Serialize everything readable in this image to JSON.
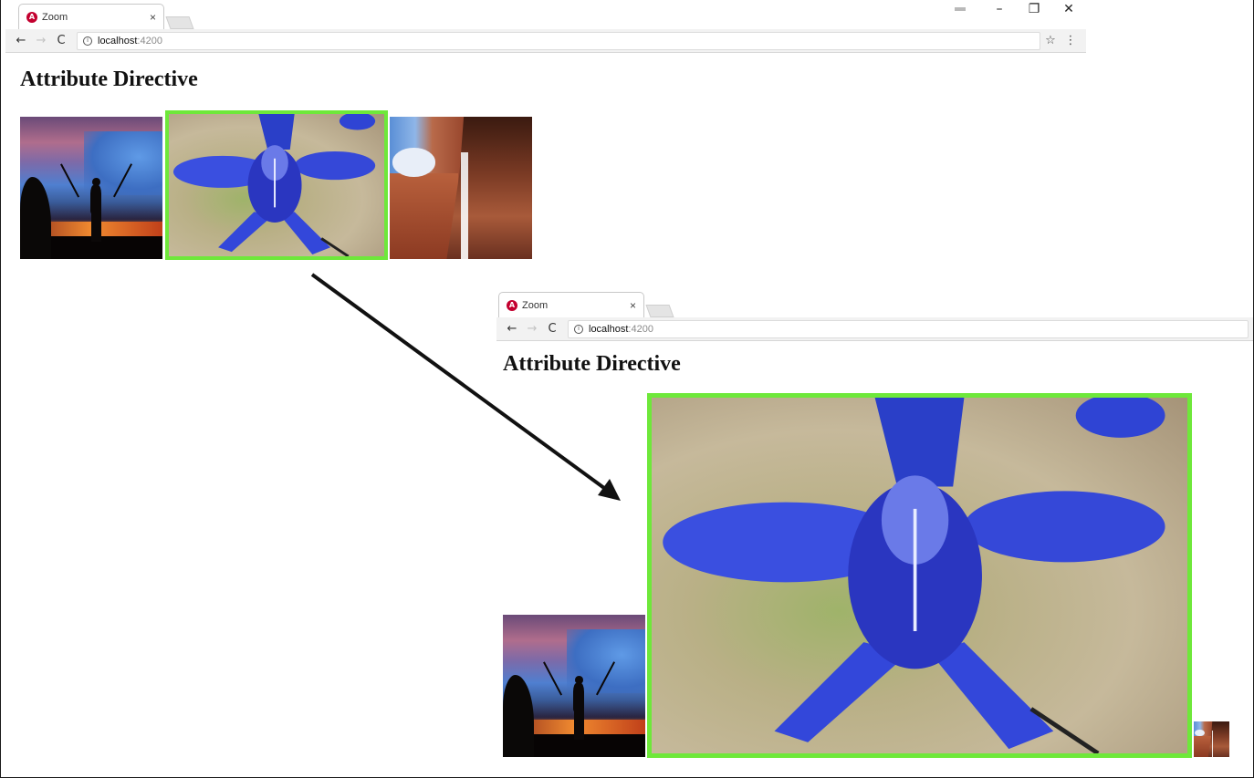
{
  "browser_top": {
    "tab": {
      "title": "Zoom",
      "close": "×",
      "logo_letter": "A"
    },
    "user_badge": "",
    "window_controls": {
      "minimize": "–",
      "restore": "❐",
      "close": "✕"
    },
    "nav": {
      "back": "←",
      "forward": "→",
      "reload": "C"
    },
    "address": {
      "host": "localhost",
      "port": ":4200"
    },
    "toolbar_icons": {
      "star": "☆",
      "menu": "⋮"
    },
    "heading": "Attribute Directive"
  },
  "browser_bottom": {
    "tab": {
      "title": "Zoom",
      "close": "×",
      "logo_letter": "A"
    },
    "nav": {
      "back": "←",
      "forward": "→",
      "reload": "C"
    },
    "address": {
      "host": "localhost",
      "port": ":4200"
    },
    "heading": "Attribute Directive"
  },
  "images": [
    {
      "name": "sunset-silhouette",
      "state": "normal"
    },
    {
      "name": "blue-iris-flower",
      "state": "hovered",
      "border_color": "#6ee83a"
    },
    {
      "name": "canyon-waterfall",
      "state": "normal"
    }
  ],
  "zoomed_images": [
    {
      "name": "sunset-silhouette",
      "state": "normal"
    },
    {
      "name": "blue-iris-flower",
      "state": "zoomed",
      "border_color": "#6ee83a"
    },
    {
      "name": "canyon-waterfall",
      "state": "shrunk"
    }
  ],
  "colors": {
    "highlight_border": "#6ee83a",
    "angular_red": "#c3002f"
  }
}
